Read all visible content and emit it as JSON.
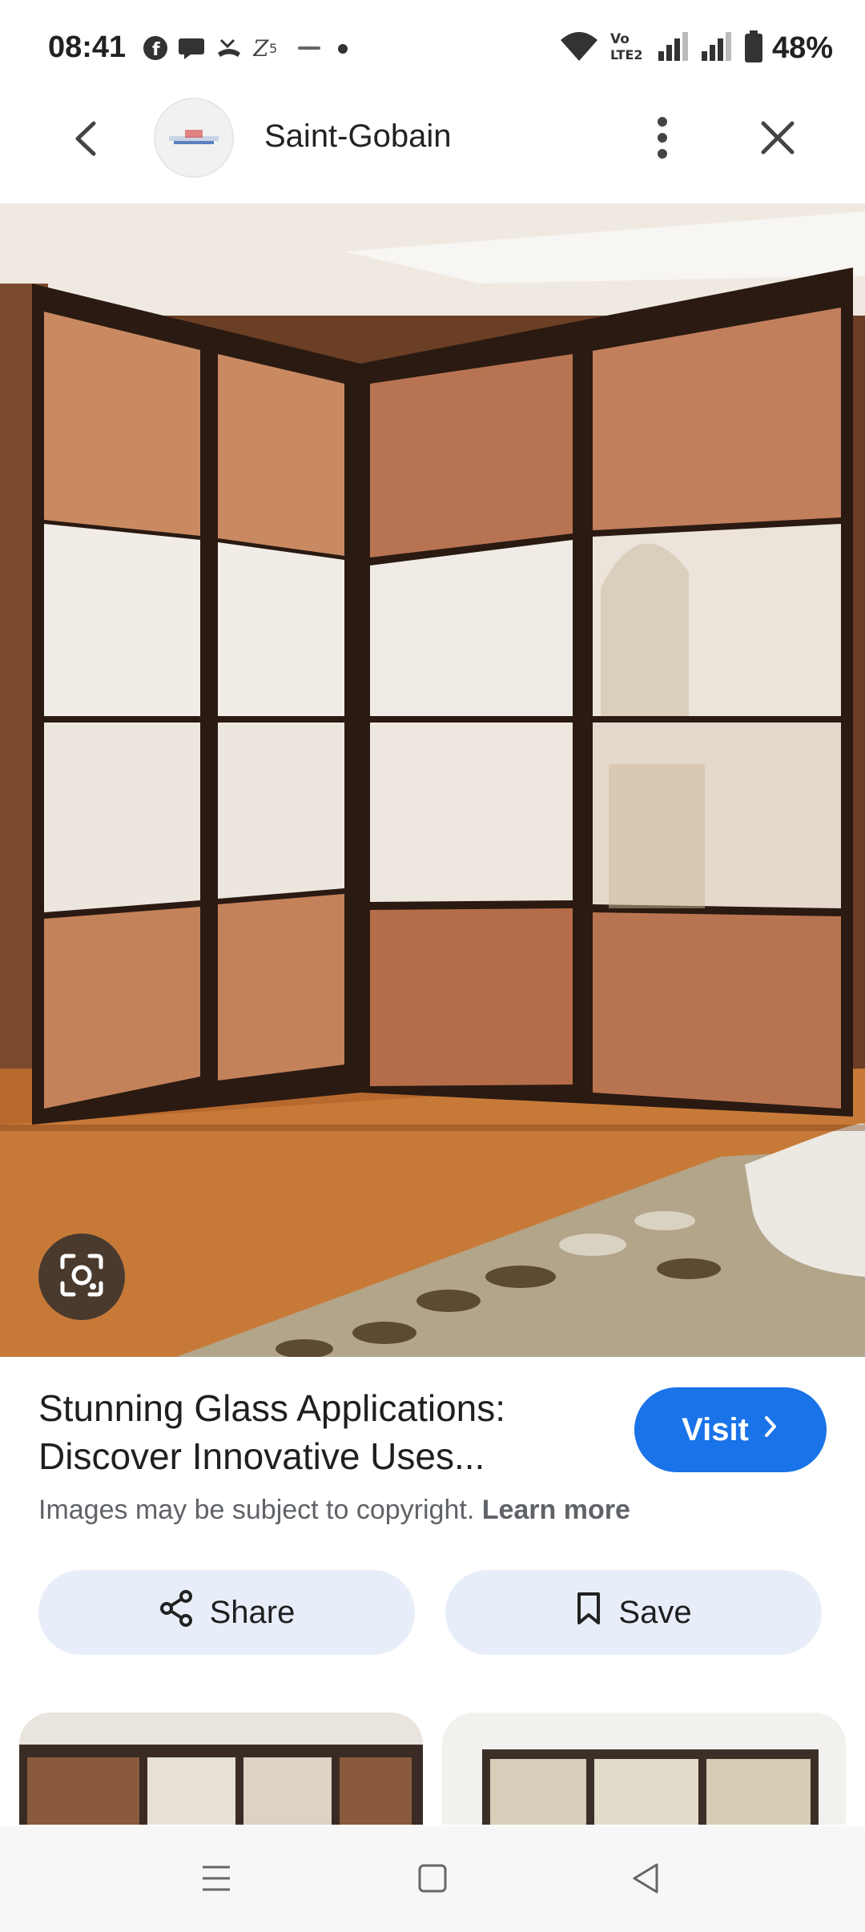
{
  "status_bar": {
    "time": "08:41",
    "battery": "48%",
    "left_icons": [
      "facebook-icon",
      "chat-icon",
      "call-missed-icon",
      "z5-icon",
      "rapido-icon",
      "dot-icon"
    ],
    "right_icons": [
      "wifi-icon",
      "volte-icon",
      "signal-icon",
      "signal-icon",
      "battery-icon"
    ]
  },
  "app_bar": {
    "title": "Saint-Gobain",
    "back_icon": "chevron-left-icon",
    "more_icon": "more-vert-icon",
    "close_icon": "close-icon"
  },
  "hero": {
    "lens_icon": "google-lens-icon"
  },
  "result": {
    "title_line1": "Stunning Glass Applications:",
    "title_line2": "Discover Innovative Uses...",
    "visit_label": "Visit",
    "copyright_text": "Images may be subject to copyright.",
    "learn_more": "Learn more"
  },
  "actions": {
    "share_label": "Share",
    "save_label": "Save"
  },
  "colors": {
    "accent": "#1a73e8",
    "action_bg": "#e8eef9"
  },
  "nav_bar": {
    "items": [
      "menu-icon",
      "home-icon",
      "back-icon"
    ]
  }
}
